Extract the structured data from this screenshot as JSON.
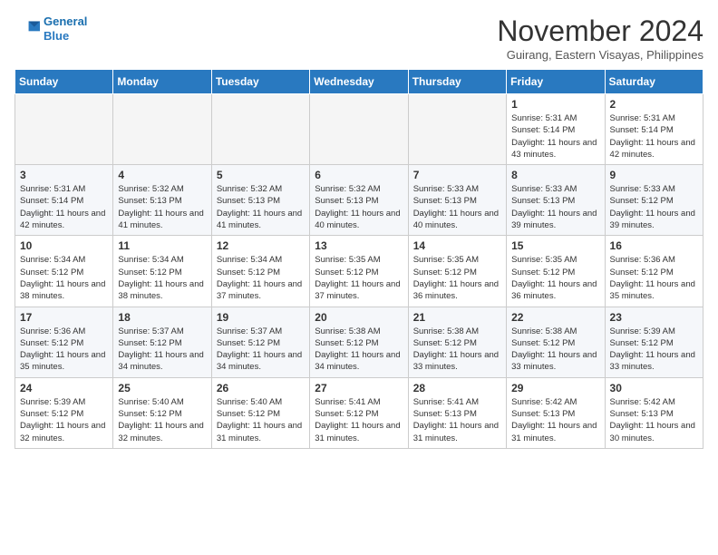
{
  "header": {
    "logo_line1": "General",
    "logo_line2": "Blue",
    "month": "November 2024",
    "location": "Guirang, Eastern Visayas, Philippines"
  },
  "weekdays": [
    "Sunday",
    "Monday",
    "Tuesday",
    "Wednesday",
    "Thursday",
    "Friday",
    "Saturday"
  ],
  "weeks": [
    [
      {
        "day": "",
        "empty": true
      },
      {
        "day": "",
        "empty": true
      },
      {
        "day": "",
        "empty": true
      },
      {
        "day": "",
        "empty": true
      },
      {
        "day": "",
        "empty": true
      },
      {
        "day": "1",
        "sunrise": "5:31 AM",
        "sunset": "5:14 PM",
        "daylight": "11 hours and 43 minutes."
      },
      {
        "day": "2",
        "sunrise": "5:31 AM",
        "sunset": "5:14 PM",
        "daylight": "11 hours and 42 minutes."
      }
    ],
    [
      {
        "day": "3",
        "sunrise": "5:31 AM",
        "sunset": "5:14 PM",
        "daylight": "11 hours and 42 minutes."
      },
      {
        "day": "4",
        "sunrise": "5:32 AM",
        "sunset": "5:13 PM",
        "daylight": "11 hours and 41 minutes."
      },
      {
        "day": "5",
        "sunrise": "5:32 AM",
        "sunset": "5:13 PM",
        "daylight": "11 hours and 41 minutes."
      },
      {
        "day": "6",
        "sunrise": "5:32 AM",
        "sunset": "5:13 PM",
        "daylight": "11 hours and 40 minutes."
      },
      {
        "day": "7",
        "sunrise": "5:33 AM",
        "sunset": "5:13 PM",
        "daylight": "11 hours and 40 minutes."
      },
      {
        "day": "8",
        "sunrise": "5:33 AM",
        "sunset": "5:13 PM",
        "daylight": "11 hours and 39 minutes."
      },
      {
        "day": "9",
        "sunrise": "5:33 AM",
        "sunset": "5:12 PM",
        "daylight": "11 hours and 39 minutes."
      }
    ],
    [
      {
        "day": "10",
        "sunrise": "5:34 AM",
        "sunset": "5:12 PM",
        "daylight": "11 hours and 38 minutes."
      },
      {
        "day": "11",
        "sunrise": "5:34 AM",
        "sunset": "5:12 PM",
        "daylight": "11 hours and 38 minutes."
      },
      {
        "day": "12",
        "sunrise": "5:34 AM",
        "sunset": "5:12 PM",
        "daylight": "11 hours and 37 minutes."
      },
      {
        "day": "13",
        "sunrise": "5:35 AM",
        "sunset": "5:12 PM",
        "daylight": "11 hours and 37 minutes."
      },
      {
        "day": "14",
        "sunrise": "5:35 AM",
        "sunset": "5:12 PM",
        "daylight": "11 hours and 36 minutes."
      },
      {
        "day": "15",
        "sunrise": "5:35 AM",
        "sunset": "5:12 PM",
        "daylight": "11 hours and 36 minutes."
      },
      {
        "day": "16",
        "sunrise": "5:36 AM",
        "sunset": "5:12 PM",
        "daylight": "11 hours and 35 minutes."
      }
    ],
    [
      {
        "day": "17",
        "sunrise": "5:36 AM",
        "sunset": "5:12 PM",
        "daylight": "11 hours and 35 minutes."
      },
      {
        "day": "18",
        "sunrise": "5:37 AM",
        "sunset": "5:12 PM",
        "daylight": "11 hours and 34 minutes."
      },
      {
        "day": "19",
        "sunrise": "5:37 AM",
        "sunset": "5:12 PM",
        "daylight": "11 hours and 34 minutes."
      },
      {
        "day": "20",
        "sunrise": "5:38 AM",
        "sunset": "5:12 PM",
        "daylight": "11 hours and 34 minutes."
      },
      {
        "day": "21",
        "sunrise": "5:38 AM",
        "sunset": "5:12 PM",
        "daylight": "11 hours and 33 minutes."
      },
      {
        "day": "22",
        "sunrise": "5:38 AM",
        "sunset": "5:12 PM",
        "daylight": "11 hours and 33 minutes."
      },
      {
        "day": "23",
        "sunrise": "5:39 AM",
        "sunset": "5:12 PM",
        "daylight": "11 hours and 33 minutes."
      }
    ],
    [
      {
        "day": "24",
        "sunrise": "5:39 AM",
        "sunset": "5:12 PM",
        "daylight": "11 hours and 32 minutes."
      },
      {
        "day": "25",
        "sunrise": "5:40 AM",
        "sunset": "5:12 PM",
        "daylight": "11 hours and 32 minutes."
      },
      {
        "day": "26",
        "sunrise": "5:40 AM",
        "sunset": "5:12 PM",
        "daylight": "11 hours and 31 minutes."
      },
      {
        "day": "27",
        "sunrise": "5:41 AM",
        "sunset": "5:12 PM",
        "daylight": "11 hours and 31 minutes."
      },
      {
        "day": "28",
        "sunrise": "5:41 AM",
        "sunset": "5:13 PM",
        "daylight": "11 hours and 31 minutes."
      },
      {
        "day": "29",
        "sunrise": "5:42 AM",
        "sunset": "5:13 PM",
        "daylight": "11 hours and 31 minutes."
      },
      {
        "day": "30",
        "sunrise": "5:42 AM",
        "sunset": "5:13 PM",
        "daylight": "11 hours and 30 minutes."
      }
    ]
  ]
}
